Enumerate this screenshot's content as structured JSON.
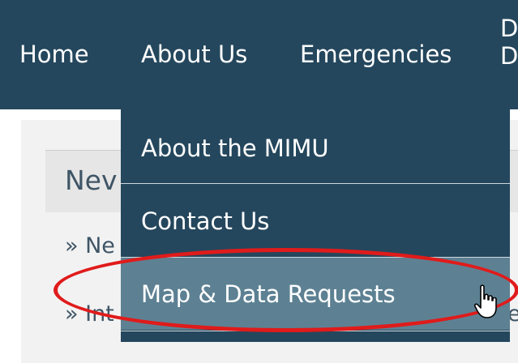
{
  "nav": {
    "items": [
      "Home",
      "About Us",
      "Emergencies"
    ],
    "cut_item_line1": "D",
    "cut_item_line2": "D"
  },
  "background": {
    "news_title": "Nev",
    "row1": "» Ne",
    "row2": "» Int",
    "row2_end": "e"
  },
  "dropdown": {
    "items": [
      "About the MIMU",
      "Contact Us",
      "Map & Data Requests"
    ],
    "highlighted_index": 2
  },
  "annotation": {
    "color": "#e01b1b",
    "shape": "ellipse"
  },
  "colors": {
    "nav_bg": "#24475d",
    "highlight_bg": "#5d8193"
  },
  "cursor": "hand-pointer-icon"
}
